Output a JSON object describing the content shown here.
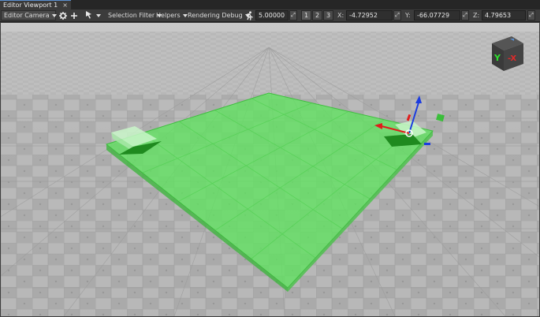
{
  "tab": {
    "title": "Editor Viewport 1",
    "close": "×"
  },
  "toolbar": {
    "camera": "Editor Camera",
    "selection_filter": "Selection Filter",
    "helpers": "Helpers",
    "rendering_debug": "Rendering Debug",
    "speed": "5.00000",
    "grid": [
      "1",
      "2",
      "3"
    ],
    "x_label": "X:",
    "x_value": "-4.72952",
    "y_label": "Y:",
    "y_value": "-66.07729",
    "z_label": "Z:",
    "z_value": "4.79653"
  },
  "view_cube": {
    "y": "Y",
    "x": "-X"
  },
  "colors": {
    "selection_green": "#5fe35f",
    "gizmo_red": "#e01c1c",
    "gizmo_blue": "#1c3ce0",
    "gizmo_green": "#1cc01c",
    "accent": "#5a8fd0"
  },
  "icons": {
    "settings": "gear-icon",
    "add": "plus-icon",
    "select": "cursor-icon",
    "camera_speed": "running-man-icon"
  }
}
